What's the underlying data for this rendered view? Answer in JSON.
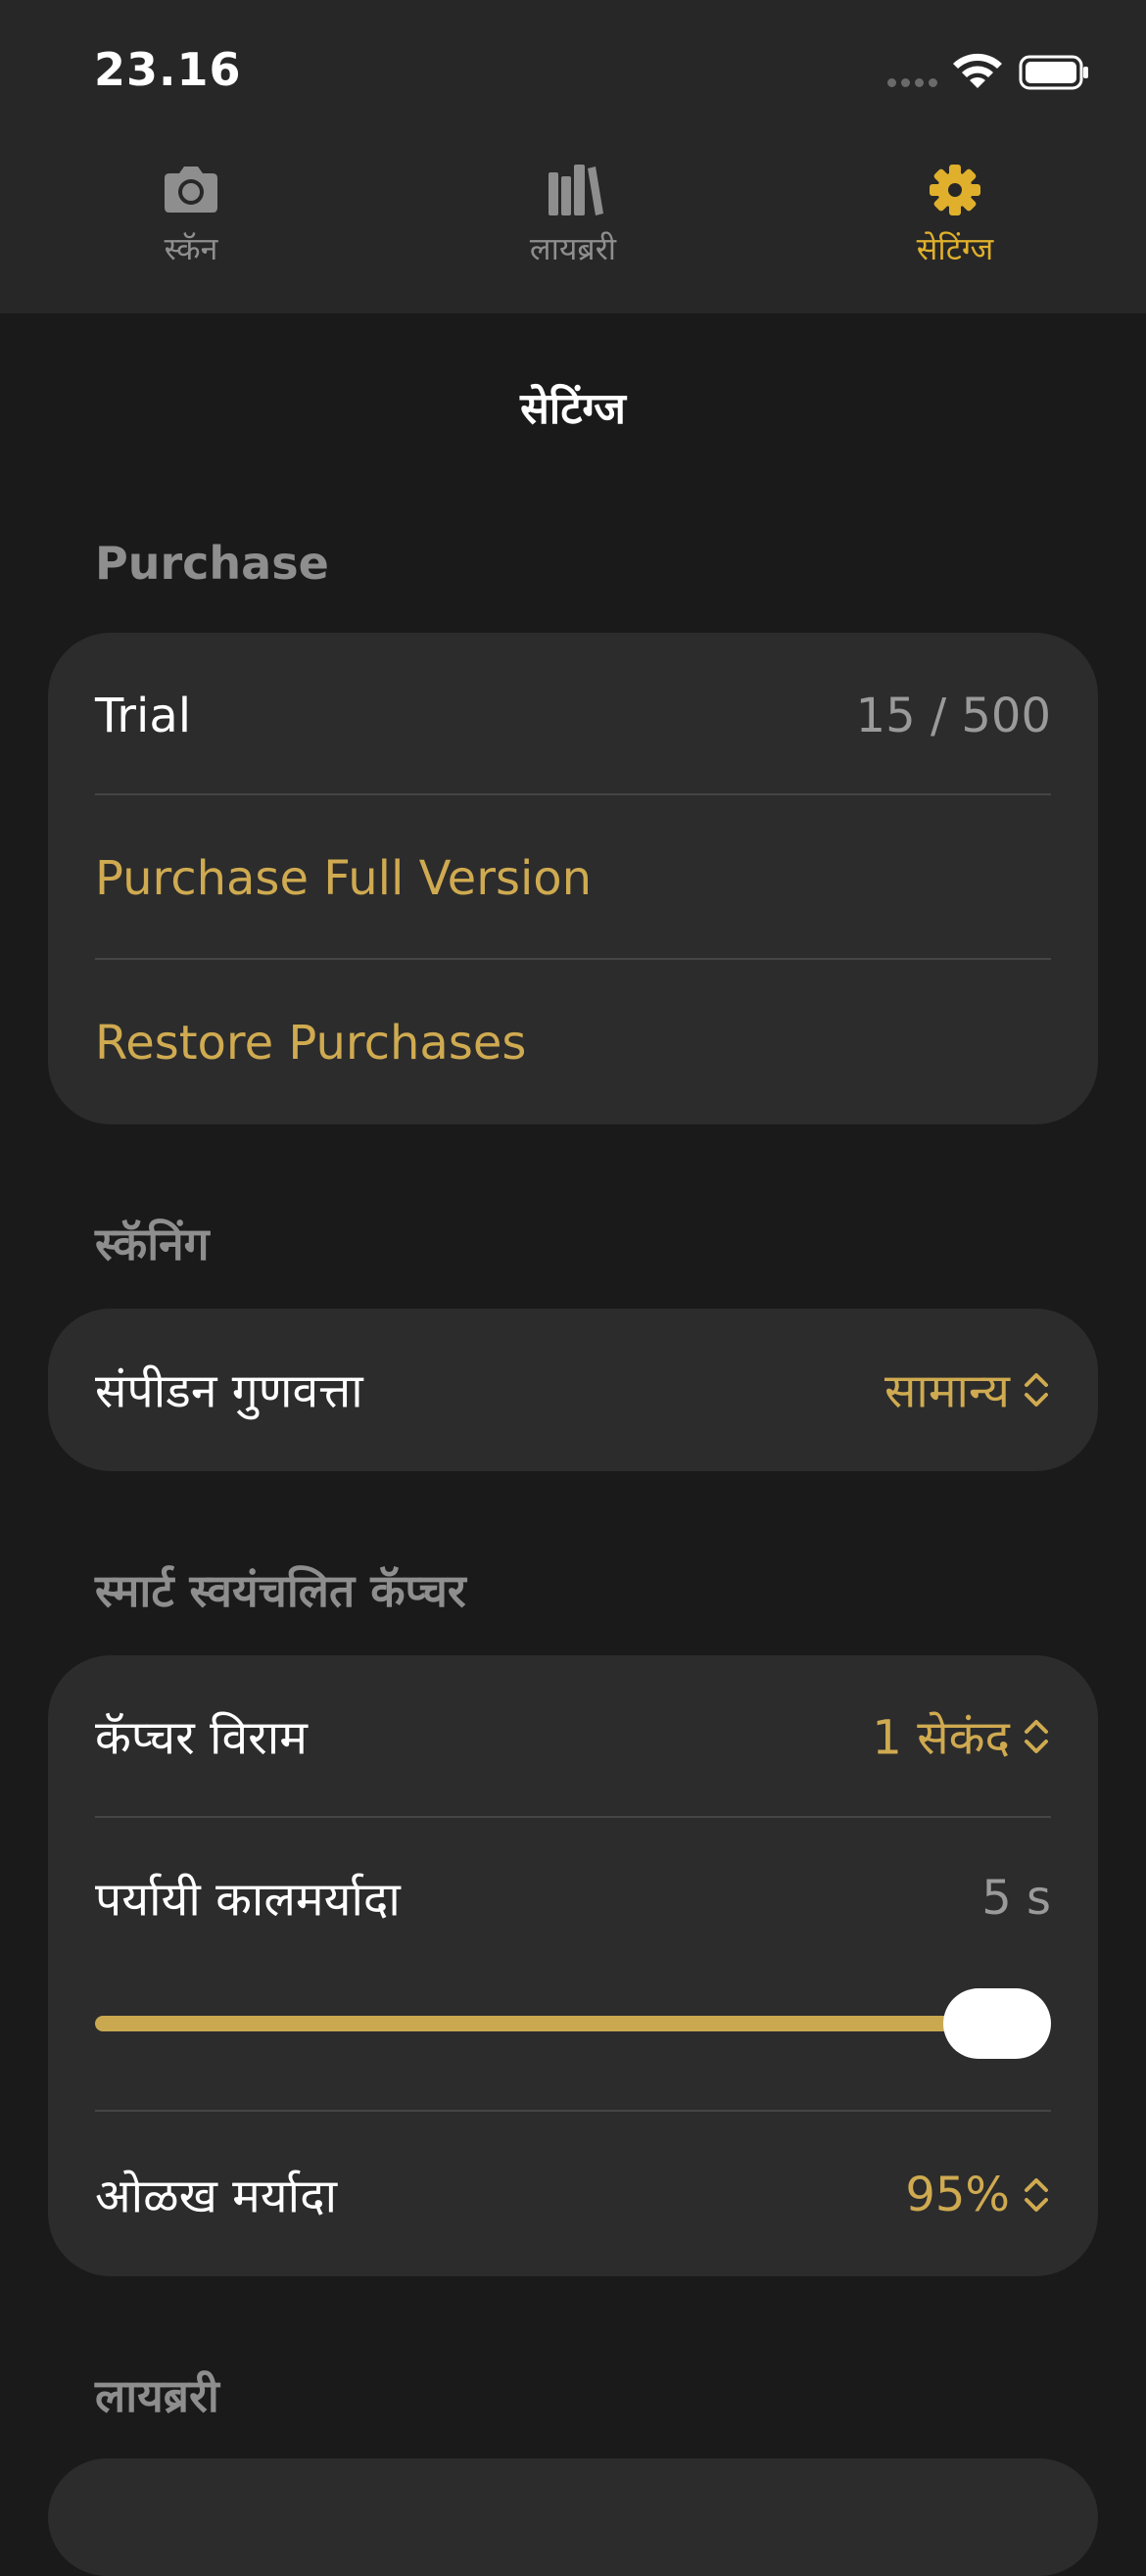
{
  "status_bar": {
    "time": "23.16"
  },
  "tabs": [
    {
      "label": "स्कॅन",
      "icon": "camera-icon",
      "active": false
    },
    {
      "label": "लायब्ररी",
      "icon": "books-icon",
      "active": false
    },
    {
      "label": "सेटिंग्ज",
      "icon": "gear-icon",
      "active": true
    }
  ],
  "page_title": "सेटिंग्ज",
  "colors": {
    "accent": "#e0b02c",
    "link": "#cfaa50",
    "card": "#2c2c2d",
    "background": "#1a1a1b",
    "bar": "#272727"
  },
  "purchase": {
    "header": "Purchase",
    "trial_label": "Trial",
    "trial_value": "15 / 500",
    "buy_label": "Purchase Full Version",
    "restore_label": "Restore Purchases"
  },
  "scanning": {
    "header": "स्कॅनिंग",
    "compression_label": "संपीडन गुणवत्ता",
    "compression_value": "सामान्य"
  },
  "auto_capture": {
    "header": "स्मार्ट स्वयंचलित कॅप्चर",
    "pause_label": "कॅप्चर विराम",
    "pause_value": "1 सेकंद",
    "timeout_label": "पर्यायी कालमर्यादा",
    "timeout_value": "5 s",
    "timeout_slider_fraction": 1.0,
    "threshold_label": "ओळख मर्यादा",
    "threshold_value": "95%"
  },
  "library": {
    "header": "लायब्ररी"
  }
}
